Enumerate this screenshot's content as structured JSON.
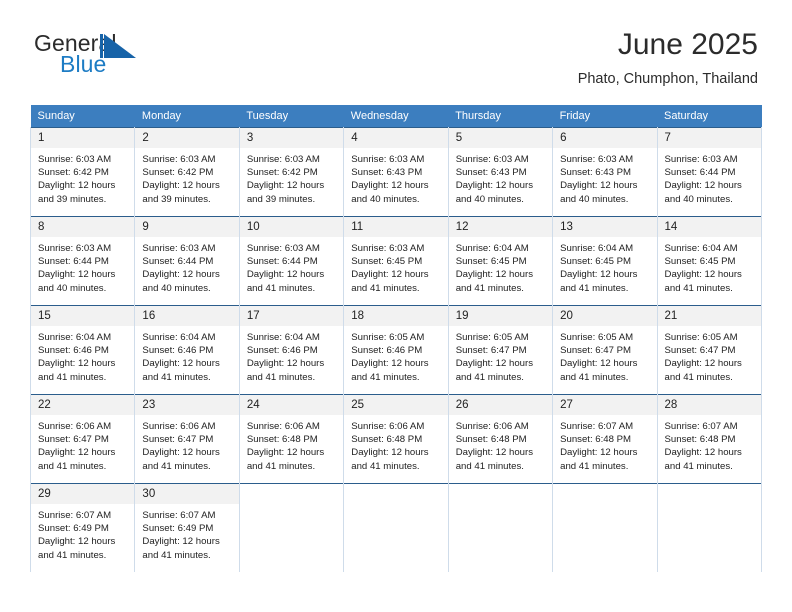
{
  "brand": {
    "name_part1": "General",
    "name_part2": "Blue",
    "logo_icon": "triangle-flag-icon",
    "accent_color": "#1d7cc4"
  },
  "header": {
    "title": "June 2025",
    "subtitle": "Phato, Chumphon, Thailand"
  },
  "calendar": {
    "header_bg": "#3c7ebf",
    "daynum_bg": "#f2f2f2",
    "weekdays": [
      "Sunday",
      "Monday",
      "Tuesday",
      "Wednesday",
      "Thursday",
      "Friday",
      "Saturday"
    ],
    "weeks": [
      [
        {
          "day": "1",
          "sunrise": "Sunrise: 6:03 AM",
          "sunset": "Sunset: 6:42 PM",
          "daylight1": "Daylight: 12 hours",
          "daylight2": "and 39 minutes."
        },
        {
          "day": "2",
          "sunrise": "Sunrise: 6:03 AM",
          "sunset": "Sunset: 6:42 PM",
          "daylight1": "Daylight: 12 hours",
          "daylight2": "and 39 minutes."
        },
        {
          "day": "3",
          "sunrise": "Sunrise: 6:03 AM",
          "sunset": "Sunset: 6:42 PM",
          "daylight1": "Daylight: 12 hours",
          "daylight2": "and 39 minutes."
        },
        {
          "day": "4",
          "sunrise": "Sunrise: 6:03 AM",
          "sunset": "Sunset: 6:43 PM",
          "daylight1": "Daylight: 12 hours",
          "daylight2": "and 40 minutes."
        },
        {
          "day": "5",
          "sunrise": "Sunrise: 6:03 AM",
          "sunset": "Sunset: 6:43 PM",
          "daylight1": "Daylight: 12 hours",
          "daylight2": "and 40 minutes."
        },
        {
          "day": "6",
          "sunrise": "Sunrise: 6:03 AM",
          "sunset": "Sunset: 6:43 PM",
          "daylight1": "Daylight: 12 hours",
          "daylight2": "and 40 minutes."
        },
        {
          "day": "7",
          "sunrise": "Sunrise: 6:03 AM",
          "sunset": "Sunset: 6:44 PM",
          "daylight1": "Daylight: 12 hours",
          "daylight2": "and 40 minutes."
        }
      ],
      [
        {
          "day": "8",
          "sunrise": "Sunrise: 6:03 AM",
          "sunset": "Sunset: 6:44 PM",
          "daylight1": "Daylight: 12 hours",
          "daylight2": "and 40 minutes."
        },
        {
          "day": "9",
          "sunrise": "Sunrise: 6:03 AM",
          "sunset": "Sunset: 6:44 PM",
          "daylight1": "Daylight: 12 hours",
          "daylight2": "and 40 minutes."
        },
        {
          "day": "10",
          "sunrise": "Sunrise: 6:03 AM",
          "sunset": "Sunset: 6:44 PM",
          "daylight1": "Daylight: 12 hours",
          "daylight2": "and 41 minutes."
        },
        {
          "day": "11",
          "sunrise": "Sunrise: 6:03 AM",
          "sunset": "Sunset: 6:45 PM",
          "daylight1": "Daylight: 12 hours",
          "daylight2": "and 41 minutes."
        },
        {
          "day": "12",
          "sunrise": "Sunrise: 6:04 AM",
          "sunset": "Sunset: 6:45 PM",
          "daylight1": "Daylight: 12 hours",
          "daylight2": "and 41 minutes."
        },
        {
          "day": "13",
          "sunrise": "Sunrise: 6:04 AM",
          "sunset": "Sunset: 6:45 PM",
          "daylight1": "Daylight: 12 hours",
          "daylight2": "and 41 minutes."
        },
        {
          "day": "14",
          "sunrise": "Sunrise: 6:04 AM",
          "sunset": "Sunset: 6:45 PM",
          "daylight1": "Daylight: 12 hours",
          "daylight2": "and 41 minutes."
        }
      ],
      [
        {
          "day": "15",
          "sunrise": "Sunrise: 6:04 AM",
          "sunset": "Sunset: 6:46 PM",
          "daylight1": "Daylight: 12 hours",
          "daylight2": "and 41 minutes."
        },
        {
          "day": "16",
          "sunrise": "Sunrise: 6:04 AM",
          "sunset": "Sunset: 6:46 PM",
          "daylight1": "Daylight: 12 hours",
          "daylight2": "and 41 minutes."
        },
        {
          "day": "17",
          "sunrise": "Sunrise: 6:04 AM",
          "sunset": "Sunset: 6:46 PM",
          "daylight1": "Daylight: 12 hours",
          "daylight2": "and 41 minutes."
        },
        {
          "day": "18",
          "sunrise": "Sunrise: 6:05 AM",
          "sunset": "Sunset: 6:46 PM",
          "daylight1": "Daylight: 12 hours",
          "daylight2": "and 41 minutes."
        },
        {
          "day": "19",
          "sunrise": "Sunrise: 6:05 AM",
          "sunset": "Sunset: 6:47 PM",
          "daylight1": "Daylight: 12 hours",
          "daylight2": "and 41 minutes."
        },
        {
          "day": "20",
          "sunrise": "Sunrise: 6:05 AM",
          "sunset": "Sunset: 6:47 PM",
          "daylight1": "Daylight: 12 hours",
          "daylight2": "and 41 minutes."
        },
        {
          "day": "21",
          "sunrise": "Sunrise: 6:05 AM",
          "sunset": "Sunset: 6:47 PM",
          "daylight1": "Daylight: 12 hours",
          "daylight2": "and 41 minutes."
        }
      ],
      [
        {
          "day": "22",
          "sunrise": "Sunrise: 6:06 AM",
          "sunset": "Sunset: 6:47 PM",
          "daylight1": "Daylight: 12 hours",
          "daylight2": "and 41 minutes."
        },
        {
          "day": "23",
          "sunrise": "Sunrise: 6:06 AM",
          "sunset": "Sunset: 6:47 PM",
          "daylight1": "Daylight: 12 hours",
          "daylight2": "and 41 minutes."
        },
        {
          "day": "24",
          "sunrise": "Sunrise: 6:06 AM",
          "sunset": "Sunset: 6:48 PM",
          "daylight1": "Daylight: 12 hours",
          "daylight2": "and 41 minutes."
        },
        {
          "day": "25",
          "sunrise": "Sunrise: 6:06 AM",
          "sunset": "Sunset: 6:48 PM",
          "daylight1": "Daylight: 12 hours",
          "daylight2": "and 41 minutes."
        },
        {
          "day": "26",
          "sunrise": "Sunrise: 6:06 AM",
          "sunset": "Sunset: 6:48 PM",
          "daylight1": "Daylight: 12 hours",
          "daylight2": "and 41 minutes."
        },
        {
          "day": "27",
          "sunrise": "Sunrise: 6:07 AM",
          "sunset": "Sunset: 6:48 PM",
          "daylight1": "Daylight: 12 hours",
          "daylight2": "and 41 minutes."
        },
        {
          "day": "28",
          "sunrise": "Sunrise: 6:07 AM",
          "sunset": "Sunset: 6:48 PM",
          "daylight1": "Daylight: 12 hours",
          "daylight2": "and 41 minutes."
        }
      ],
      [
        {
          "day": "29",
          "sunrise": "Sunrise: 6:07 AM",
          "sunset": "Sunset: 6:49 PM",
          "daylight1": "Daylight: 12 hours",
          "daylight2": "and 41 minutes."
        },
        {
          "day": "30",
          "sunrise": "Sunrise: 6:07 AM",
          "sunset": "Sunset: 6:49 PM",
          "daylight1": "Daylight: 12 hours",
          "daylight2": "and 41 minutes."
        },
        {
          "day": "",
          "sunrise": "",
          "sunset": "",
          "daylight1": "",
          "daylight2": ""
        },
        {
          "day": "",
          "sunrise": "",
          "sunset": "",
          "daylight1": "",
          "daylight2": ""
        },
        {
          "day": "",
          "sunrise": "",
          "sunset": "",
          "daylight1": "",
          "daylight2": ""
        },
        {
          "day": "",
          "sunrise": "",
          "sunset": "",
          "daylight1": "",
          "daylight2": ""
        },
        {
          "day": "",
          "sunrise": "",
          "sunset": "",
          "daylight1": "",
          "daylight2": ""
        }
      ]
    ]
  }
}
